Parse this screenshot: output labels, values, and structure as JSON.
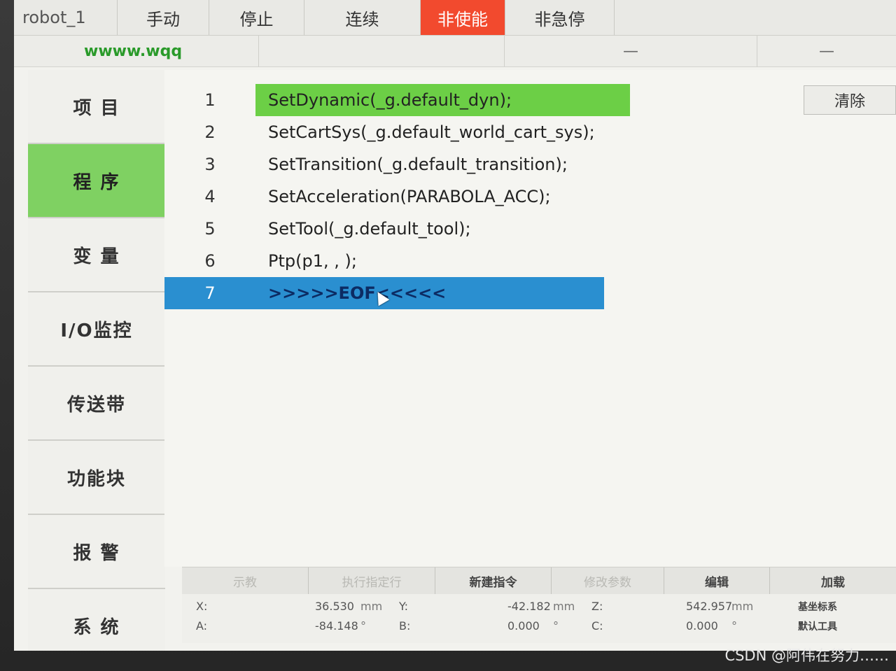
{
  "topbar": {
    "robot": "robot_1",
    "tabs": [
      "手动",
      "停止",
      "连续",
      "非使能",
      "非急停"
    ]
  },
  "subbar": {
    "site": "wwww.wqq",
    "dash1": "—",
    "dash2": "—"
  },
  "sidebar": {
    "items": [
      "项 目",
      "程 序",
      "变 量",
      "I/O监控",
      "传送带",
      "功能块",
      "报 警",
      "系 统"
    ]
  },
  "program": {
    "clear_label": "清除",
    "lines": [
      {
        "num": "1",
        "code": "SetDynamic(_g.default_dyn);"
      },
      {
        "num": "2",
        "code": "SetCartSys(_g.default_world_cart_sys);"
      },
      {
        "num": "3",
        "code": "SetTransition(_g.default_transition);"
      },
      {
        "num": "4",
        "code": "SetAcceleration(PARABOLA_ACC);"
      },
      {
        "num": "5",
        "code": "SetTool(_g.default_tool);"
      },
      {
        "num": "6",
        "code": "Ptp(p1, , );"
      },
      {
        "num": "7",
        "code": ">>>>>EOF<<<<<"
      }
    ]
  },
  "toolbar": {
    "buttons": [
      "示教",
      "执行指定行",
      "新建指令",
      "修改参数",
      "编辑",
      "加载"
    ]
  },
  "coords": {
    "x_label": "X:",
    "x_val": "36.530",
    "x_unit": "mm",
    "y_label": "Y:",
    "y_val": "-42.182",
    "y_unit": "mm",
    "z_label": "Z:",
    "z_val": "542.957",
    "z_unit": "mm",
    "a_label": "A:",
    "a_val": "-84.148",
    "a_unit": "°",
    "b_label": "B:",
    "b_val": "0.000",
    "b_unit": "°",
    "c_label": "C:",
    "c_val": "0.000",
    "c_unit": "°",
    "frame": "基坐标系",
    "tool": "默认工具"
  },
  "watermark": "CSDN @阿伟在努力……",
  "colors": {
    "active_green": "#7fd162",
    "current_line": "#6ccf46",
    "selected_blue": "#2a8fd0",
    "disable_red": "#f24a2e"
  }
}
